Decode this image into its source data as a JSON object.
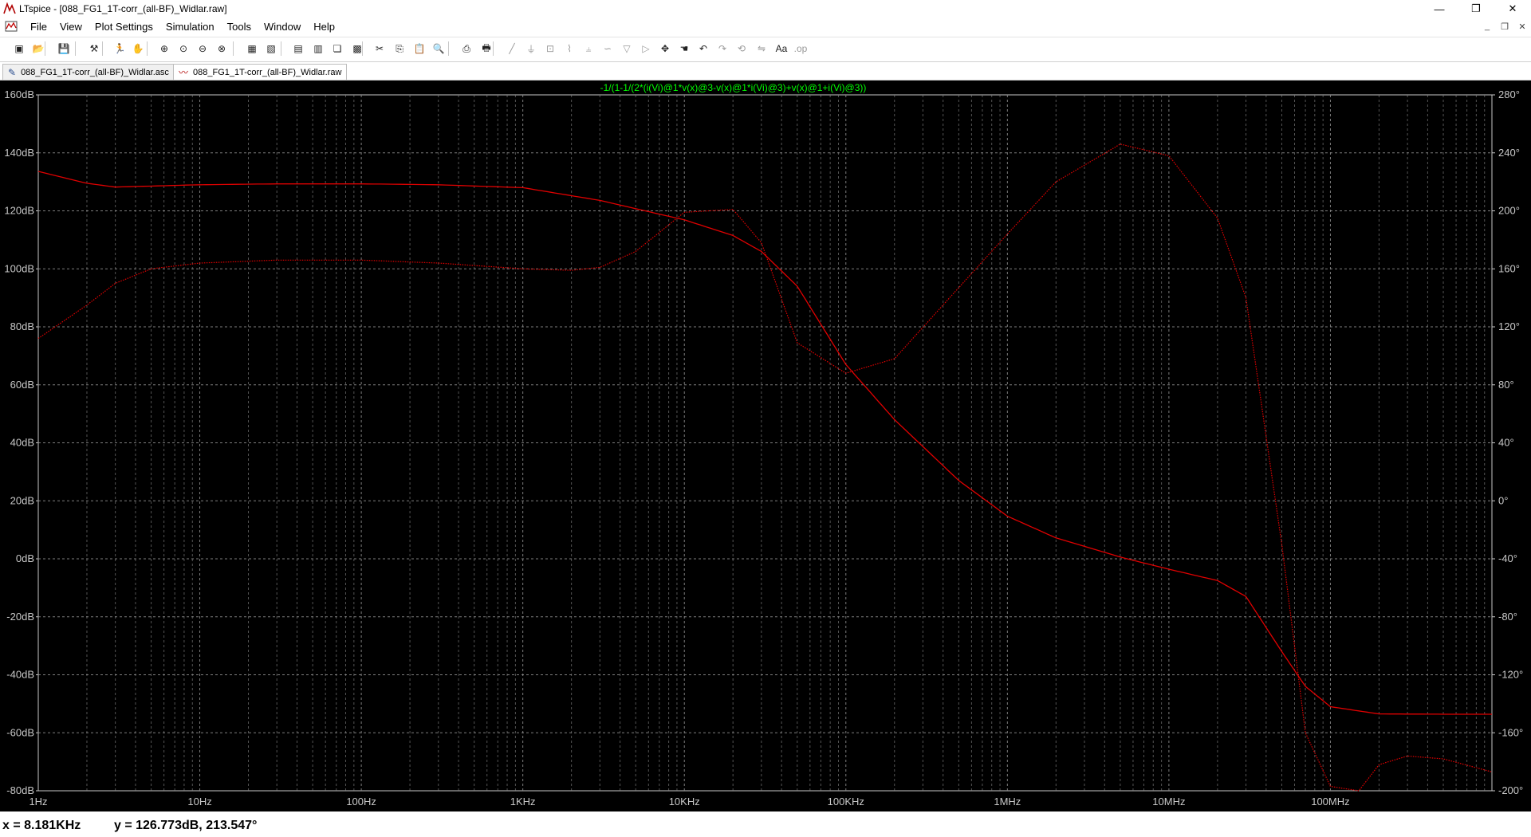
{
  "window": {
    "title": "LTspice - [088_FG1_1T-corr_(all-BF)_Widlar.raw]",
    "minimize": "—",
    "restore": "❐",
    "close": "✕"
  },
  "menu": {
    "items": [
      "File",
      "View",
      "Plot Settings",
      "Simulation",
      "Tools",
      "Window",
      "Help"
    ]
  },
  "mdi_controls": {
    "minimize": "_",
    "restore": "❐",
    "close": "✕"
  },
  "toolbar": {
    "buttons": [
      {
        "icon": "new-schematic-icon",
        "glyph": "▣",
        "enabled": true
      },
      {
        "icon": "open-icon",
        "glyph": "📂",
        "enabled": true
      },
      {
        "icon": "save-icon",
        "glyph": "💾",
        "enabled": true
      },
      {
        "icon": "control-panel-icon",
        "glyph": "⚒",
        "enabled": true
      },
      {
        "icon": "run-icon",
        "glyph": "🏃",
        "enabled": true
      },
      {
        "icon": "halt-icon",
        "glyph": "✋",
        "enabled": false
      },
      {
        "icon": "zoom-in-icon",
        "glyph": "⊕",
        "enabled": true
      },
      {
        "icon": "pan-icon",
        "glyph": "⊙",
        "enabled": true
      },
      {
        "icon": "zoom-out-icon",
        "glyph": "⊖",
        "enabled": true
      },
      {
        "icon": "zoom-cancel-icon",
        "glyph": "⊗",
        "enabled": true
      },
      {
        "icon": "autorange-icon",
        "glyph": "▦",
        "enabled": true
      },
      {
        "icon": "pick-visible-traces-icon",
        "glyph": "▧",
        "enabled": true
      },
      {
        "icon": "tile-horizontal-icon",
        "glyph": "▤",
        "enabled": true
      },
      {
        "icon": "tile-vertical-icon",
        "glyph": "▥",
        "enabled": true
      },
      {
        "icon": "cascade-icon",
        "glyph": "❏",
        "enabled": true
      },
      {
        "icon": "close-all-icon",
        "glyph": "▩",
        "enabled": true
      },
      {
        "icon": "cut-icon",
        "glyph": "✂",
        "enabled": true
      },
      {
        "icon": "copy-icon",
        "glyph": "⎘",
        "enabled": true
      },
      {
        "icon": "paste-icon",
        "glyph": "📋",
        "enabled": true
      },
      {
        "icon": "find-icon",
        "glyph": "🔍",
        "enabled": true
      },
      {
        "icon": "print-setup-icon",
        "glyph": "⎙",
        "enabled": true
      },
      {
        "icon": "print-icon",
        "glyph": "🖶",
        "enabled": true
      },
      {
        "icon": "wire-icon",
        "glyph": "╱",
        "enabled": false
      },
      {
        "icon": "ground-icon",
        "glyph": "⏚",
        "enabled": false
      },
      {
        "icon": "label-net-icon",
        "glyph": "⊡",
        "enabled": false
      },
      {
        "icon": "resistor-icon",
        "glyph": "⌇",
        "enabled": false
      },
      {
        "icon": "capacitor-icon",
        "glyph": "⫨",
        "enabled": false
      },
      {
        "icon": "inductor-icon",
        "glyph": "∽",
        "enabled": false
      },
      {
        "icon": "diode-icon",
        "glyph": "▽",
        "enabled": false
      },
      {
        "icon": "component-icon",
        "glyph": "▷",
        "enabled": false
      },
      {
        "icon": "move-icon",
        "glyph": "✥",
        "enabled": true
      },
      {
        "icon": "drag-icon",
        "glyph": "☚",
        "enabled": true
      },
      {
        "icon": "undo-icon",
        "glyph": "↶",
        "enabled": true
      },
      {
        "icon": "redo-icon",
        "glyph": "↷",
        "enabled": false
      },
      {
        "icon": "rotate-icon",
        "glyph": "⟲",
        "enabled": false
      },
      {
        "icon": "mirror-icon",
        "glyph": "⇋",
        "enabled": false
      },
      {
        "icon": "text-icon",
        "glyph": "Aa",
        "enabled": true
      },
      {
        "icon": "spice-directive-icon",
        "glyph": ".op",
        "enabled": false
      }
    ]
  },
  "tabs": [
    {
      "label": "088_FG1_1T-corr_(all-BF)_Widlar.asc",
      "icon": "schematic-icon",
      "glyph": "✎",
      "active": false
    },
    {
      "label": "088_FG1_1T-corr_(all-BF)_Widlar.raw",
      "icon": "waveform-icon",
      "glyph": "〰",
      "active": true
    }
  ],
  "plot": {
    "background": "#000000",
    "grid_color": "#8c8c8c",
    "axis_text_color": "#c8c8c8",
    "trace_color": "#e00000",
    "trace_label_color": "#00ff00"
  },
  "chart_data": {
    "type": "line",
    "title": "-1/(1-1/(2*(i(Vi)@1*v(x)@3-v(x)@1*i(Vi)@3)+v(x)@1+i(Vi)@3))",
    "x_scale": "log",
    "xlim": [
      1,
      1000000000
    ],
    "ylim": [
      -80,
      160
    ],
    "y2lim": [
      -200,
      280
    ],
    "x_ticks": [
      {
        "value": 1,
        "label": "1Hz"
      },
      {
        "value": 10,
        "label": "10Hz"
      },
      {
        "value": 100,
        "label": "100Hz"
      },
      {
        "value": 1000,
        "label": "1KHz"
      },
      {
        "value": 10000,
        "label": "10KHz"
      },
      {
        "value": 100000,
        "label": "100KHz"
      },
      {
        "value": 1000000,
        "label": "1MHz"
      },
      {
        "value": 10000000,
        "label": "10MHz"
      },
      {
        "value": 100000000,
        "label": "100MHz"
      }
    ],
    "y_ticks": [
      {
        "value": 160,
        "label": "160dB"
      },
      {
        "value": 140,
        "label": "140dB"
      },
      {
        "value": 120,
        "label": "120dB"
      },
      {
        "value": 100,
        "label": "100dB"
      },
      {
        "value": 80,
        "label": "80dB"
      },
      {
        "value": 60,
        "label": "60dB"
      },
      {
        "value": 40,
        "label": "40dB"
      },
      {
        "value": 20,
        "label": "20dB"
      },
      {
        "value": 0,
        "label": "0dB"
      },
      {
        "value": -20,
        "label": "-20dB"
      },
      {
        "value": -40,
        "label": "-40dB"
      },
      {
        "value": -60,
        "label": "-60dB"
      },
      {
        "value": -80,
        "label": "-80dB"
      }
    ],
    "y2_ticks": [
      {
        "value": 280,
        "label": "280°"
      },
      {
        "value": 240,
        "label": "240°"
      },
      {
        "value": 200,
        "label": "200°"
      },
      {
        "value": 160,
        "label": "160°"
      },
      {
        "value": 120,
        "label": "120°"
      },
      {
        "value": 80,
        "label": "80°"
      },
      {
        "value": 40,
        "label": "40°"
      },
      {
        "value": 0,
        "label": "0°"
      },
      {
        "value": -40,
        "label": "-40°"
      },
      {
        "value": -80,
        "label": "-80°"
      },
      {
        "value": -120,
        "label": "-120°"
      },
      {
        "value": -160,
        "label": "-160°"
      },
      {
        "value": -200,
        "label": "-200°"
      }
    ],
    "grid": true,
    "series": [
      {
        "axis": "left",
        "style": "solid",
        "points": [
          [
            1,
            133.6
          ],
          [
            2,
            129.5
          ],
          [
            3,
            128.2
          ],
          [
            10,
            129
          ],
          [
            30,
            129.3
          ],
          [
            100,
            129.3
          ],
          [
            300,
            129
          ],
          [
            1000,
            128
          ],
          [
            3000,
            123.6
          ],
          [
            10000,
            116.9
          ],
          [
            20000,
            111.5
          ],
          [
            30000,
            106
          ],
          [
            50000,
            94
          ],
          [
            100000,
            67
          ],
          [
            200000,
            48
          ],
          [
            500000,
            27
          ],
          [
            1000000,
            14.7
          ],
          [
            2000000,
            7.2
          ],
          [
            5000000,
            0.6
          ],
          [
            10000000,
            -3.6
          ],
          [
            20000000,
            -7.5
          ],
          [
            30000000,
            -13
          ],
          [
            50000000,
            -32
          ],
          [
            70000000,
            -44
          ],
          [
            100000000,
            -51
          ],
          [
            200000000,
            -53.5
          ],
          [
            500000000,
            -53.6
          ],
          [
            1000000000,
            -53.6
          ]
        ]
      },
      {
        "axis": "right",
        "style": "dotted",
        "points": [
          [
            1,
            112
          ],
          [
            2,
            135
          ],
          [
            3,
            150
          ],
          [
            5,
            160
          ],
          [
            10,
            164
          ],
          [
            30,
            166
          ],
          [
            100,
            166
          ],
          [
            300,
            164
          ],
          [
            1000,
            160
          ],
          [
            2000,
            159
          ],
          [
            3000,
            161
          ],
          [
            5000,
            172
          ],
          [
            10000,
            199
          ],
          [
            20000,
            201
          ],
          [
            30000,
            178
          ],
          [
            50000,
            109
          ],
          [
            100000,
            88
          ],
          [
            200000,
            98
          ],
          [
            500000,
            147
          ],
          [
            1000000,
            184
          ],
          [
            2000000,
            220
          ],
          [
            5000000,
            246
          ],
          [
            10000000,
            238
          ],
          [
            20000000,
            195
          ],
          [
            30000000,
            140
          ],
          [
            50000000,
            -30
          ],
          [
            70000000,
            -160
          ],
          [
            100000000,
            -197
          ],
          [
            150000000,
            -200
          ],
          [
            200000000,
            -182
          ],
          [
            300000000,
            -176
          ],
          [
            500000000,
            -178
          ],
          [
            1000000000,
            -187
          ]
        ]
      }
    ]
  },
  "status": {
    "x_readout": "x = 8.181KHz",
    "y_readout": "y = 126.773dB, 213.547°"
  }
}
